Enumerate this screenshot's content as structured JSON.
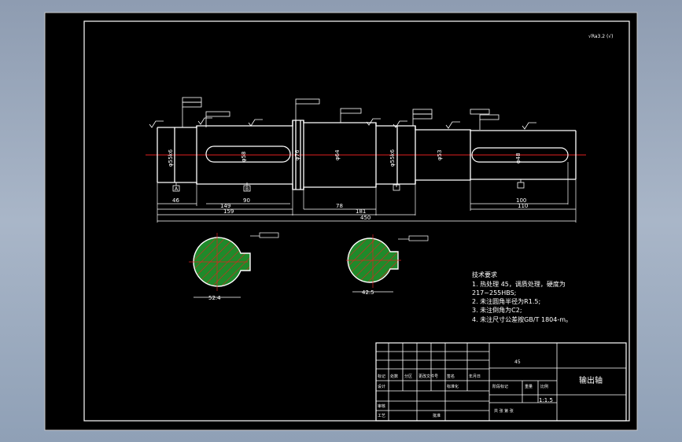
{
  "colors": {
    "background": "#97a6ba",
    "sheet": "#000000",
    "lines": "#ffffff",
    "centerline": "#e02020",
    "hatch_fill": "#1f8a2a",
    "hatch_lines": "#e02020"
  },
  "roughness_note": "√Ra3.2 (√)",
  "annotations": {
    "label_a": "A",
    "label_b": "B"
  },
  "dimensions": {
    "d55_left": "φ55k6",
    "d58": "φ58",
    "d76": "φ76",
    "d64": "φ64",
    "d55_right": "φ55k6",
    "d53": "φ53",
    "d48": "φ48",
    "len_46": "46",
    "len_90_a": "90",
    "len_149": "149",
    "len_159": "159",
    "len_78": "78",
    "len_181": "181",
    "len_450": "450",
    "len_100": "100",
    "len_110": "110"
  },
  "sections": {
    "left_bottom": "52.4",
    "right_bottom": "42.5"
  },
  "tech_requirements": {
    "title": "技术要求",
    "line1": "1. 热处理  45，调质处理，硬度为",
    "line2": "217~255HBS;",
    "line3": "2. 未注圆角半径为R1.5;",
    "line4": "3. 未注倒角为C2;",
    "line5": "4. 未注尺寸公差按GB/T 1804-m。"
  },
  "title_block": {
    "part_name": "输出轴",
    "material": "45",
    "scale": "1:1.5",
    "row_labels": [
      "标记",
      "处数",
      "分区",
      "更改文件号",
      "签名",
      "年月日"
    ],
    "design": "设计",
    "standard": "标准化",
    "stage_mark": "阶段标记",
    "weight": "重量",
    "ratio": "比例",
    "review": "审核",
    "process": "工艺",
    "approve": "批准",
    "sheets": "共  张  第  张"
  }
}
